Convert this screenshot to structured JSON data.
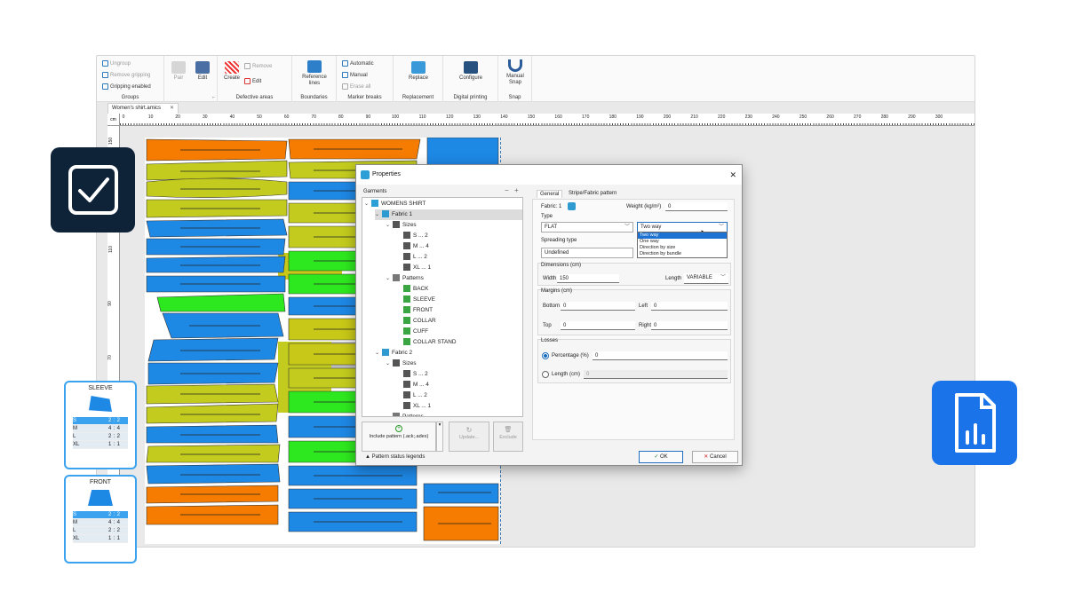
{
  "ribbon": {
    "groups_items": [
      "Ungroup",
      "Remove gripping",
      "Gripping enabled"
    ],
    "groups_caption": "Groups",
    "pair": "Pair",
    "edit": "Edit",
    "create": "Create",
    "remove": "Remove",
    "edit2": "Edit",
    "defective_caption": "Defective areas",
    "reference_lines": "Reference lines",
    "boundaries_caption": "Boundaries",
    "marker_breaks_items": [
      "Automatic",
      "Manual",
      "Erase all"
    ],
    "marker_breaks_caption": "Marker breaks",
    "replace": "Replace",
    "replacement_caption": "Replacement",
    "configure": "Configure",
    "digital_caption": "Digital printing",
    "manual_snap": "Manual Snap",
    "snap_caption": "Snap"
  },
  "document_tab": "Women's shirt.amics",
  "ruler": {
    "unit": "cm",
    "top_ticks": [
      "0",
      "10",
      "20",
      "30",
      "40",
      "50",
      "60",
      "70",
      "80",
      "90",
      "100",
      "110",
      "120",
      "130",
      "140",
      "150",
      "160",
      "170",
      "180",
      "190",
      "200",
      "210",
      "220",
      "230",
      "240",
      "250",
      "260",
      "270",
      "280",
      "290",
      "300"
    ],
    "left_ticks": [
      "150",
      "130",
      "110",
      "90",
      "70"
    ]
  },
  "cards": [
    {
      "title": "SLEEVE",
      "rows": [
        {
          "size": "S",
          "a": "2",
          "b": "2",
          "sel": true
        },
        {
          "size": "M",
          "a": "4",
          "b": "4",
          "sel": false
        },
        {
          "size": "L",
          "a": "2",
          "b": "2",
          "sel": false
        },
        {
          "size": "XL",
          "a": "1",
          "b": "1",
          "sel": false
        }
      ]
    },
    {
      "title": "FRONT",
      "rows": [
        {
          "size": "S",
          "a": "2",
          "b": "2",
          "sel": true
        },
        {
          "size": "M",
          "a": "4",
          "b": "4",
          "sel": false
        },
        {
          "size": "L",
          "a": "2",
          "b": "2",
          "sel": false
        },
        {
          "size": "XL",
          "a": "1",
          "b": "1",
          "sel": false
        }
      ]
    }
  ],
  "dialog": {
    "title": "Properties",
    "garments_label": "Garments",
    "tree": [
      {
        "label": "WOMENS SHIRT",
        "level": 0,
        "icon": "garment-icon"
      },
      {
        "label": "Fabric 1",
        "level": 1,
        "icon": "fabric-icon",
        "selected": true
      },
      {
        "label": "Sizes",
        "level": 2,
        "icon": "grid-icon"
      },
      {
        "label": "S ... 2",
        "level": 3,
        "icon": "grid-icon"
      },
      {
        "label": "M ... 4",
        "level": 3,
        "icon": "grid-icon"
      },
      {
        "label": "L ... 2",
        "level": 3,
        "icon": "grid-icon"
      },
      {
        "label": "XL ... 1",
        "level": 3,
        "icon": "grid-icon"
      },
      {
        "label": "Patterns",
        "level": 2,
        "icon": "pattern-icon"
      },
      {
        "label": "BACK",
        "level": 3,
        "icon": "check-pattern-icon"
      },
      {
        "label": "SLEEVE",
        "level": 3,
        "icon": "check-pattern-icon"
      },
      {
        "label": "FRONT",
        "level": 3,
        "icon": "check-pattern-icon"
      },
      {
        "label": "COLLAR",
        "level": 3,
        "icon": "check-pattern-icon"
      },
      {
        "label": "CUFF",
        "level": 3,
        "icon": "check-pattern-icon"
      },
      {
        "label": "COLLAR STAND",
        "level": 3,
        "icon": "check-pattern-icon"
      },
      {
        "label": "Fabric 2",
        "level": 1,
        "icon": "fabric-icon"
      },
      {
        "label": "Sizes",
        "level": 2,
        "icon": "grid-icon"
      },
      {
        "label": "S ... 2",
        "level": 3,
        "icon": "grid-icon"
      },
      {
        "label": "M ... 4",
        "level": 3,
        "icon": "grid-icon"
      },
      {
        "label": "L ... 2",
        "level": 3,
        "icon": "grid-icon"
      },
      {
        "label": "XL ... 1",
        "level": 3,
        "icon": "grid-icon"
      },
      {
        "label": "Patterns",
        "level": 2,
        "icon": "pattern-icon"
      }
    ],
    "include_pattern": "Include pattern (.ack;.adex)",
    "update": "Update...",
    "exclude": "Exclude",
    "legend_link": "Pattern status legends",
    "tabs": [
      "General",
      "Stripe/Fabric pattern"
    ],
    "fabric_label": "Fabric: 1",
    "weight_label": "Weight (kg/m²)",
    "weight_value": "0",
    "type_label": "Type",
    "type_value": "FLAT",
    "direction_value": "Two way",
    "direction_options": [
      "Two way",
      "One way",
      "Direction by size",
      "Direction by bundle"
    ],
    "spreading_label": "Spreading type",
    "spreading_value": "Undefined",
    "dimensions_label": "Dimensions (cm)",
    "width_label": "Width",
    "width_value": "150",
    "length_label": "Length",
    "length_value": "VARIABLE",
    "margins_label": "Margins (cm)",
    "bottom_label": "Bottom",
    "bottom_value": "0",
    "left_label": "Left",
    "left_value": "0",
    "top_label": "Top",
    "top_value": "0",
    "right_label": "Right",
    "right_value": "0",
    "losses_label": "Losses",
    "percentage_label": "Percentage (%)",
    "percentage_value": "0",
    "length_cm_label": "Length (cm)",
    "length_cm_value": "0",
    "ok": "OK",
    "cancel": "Cancel"
  },
  "colors": {
    "accent": "#1a73e8",
    "orange": "#f57c00",
    "yellowgreen": "#c3cc1e",
    "blue": "#1e88e5",
    "green": "#2ee81f"
  }
}
